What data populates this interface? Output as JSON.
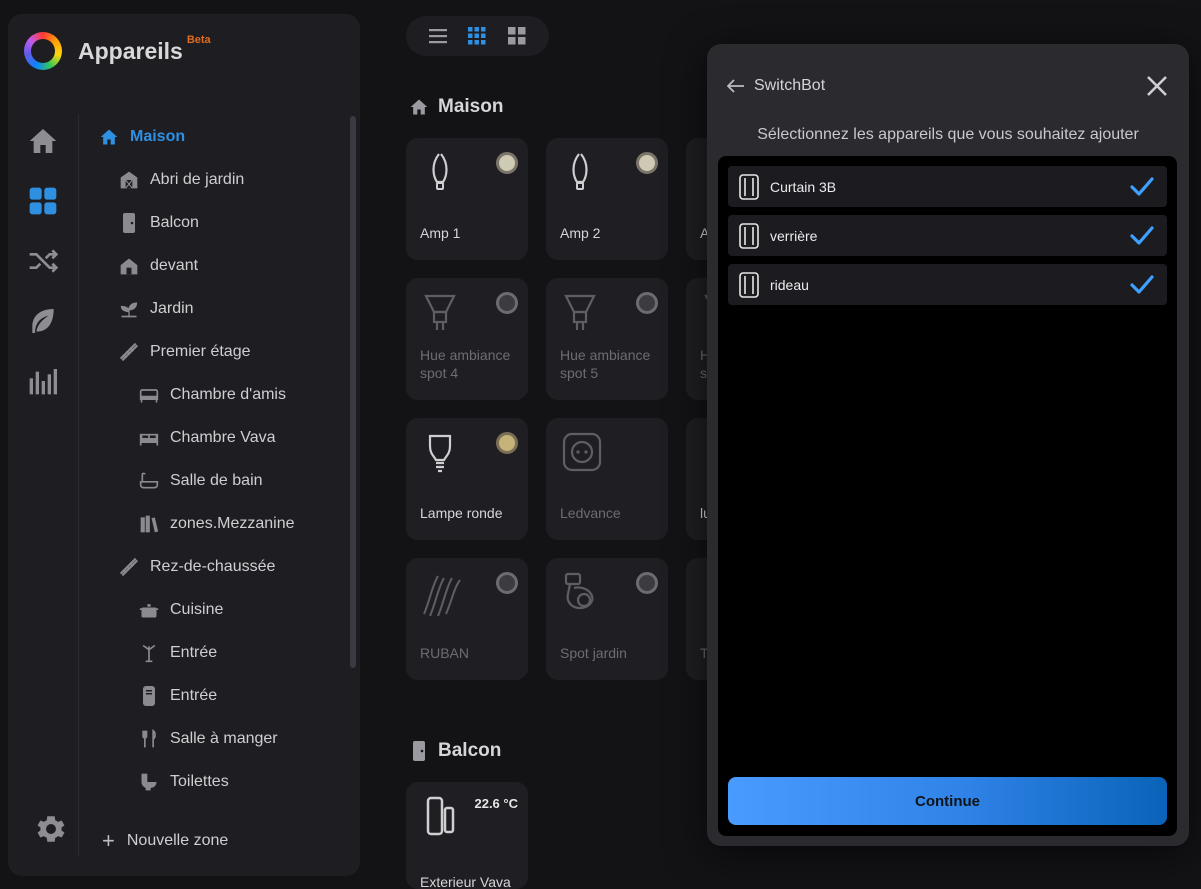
{
  "app": {
    "name": "Appareils",
    "badge": "Beta"
  },
  "zones": [
    {
      "label": "Maison",
      "icon": "house-icon",
      "level": 0,
      "active": true
    },
    {
      "label": "Abri de jardin",
      "icon": "shed-icon",
      "level": 1
    },
    {
      "label": "Balcon",
      "icon": "door-icon",
      "level": 1
    },
    {
      "label": "devant",
      "icon": "house-small-icon",
      "level": 1
    },
    {
      "label": "Jardin",
      "icon": "plant-icon",
      "level": 1
    },
    {
      "label": "Premier étage",
      "icon": "stairs-icon",
      "level": 1
    },
    {
      "label": "Chambre d'amis",
      "icon": "bed-icon",
      "level": 2
    },
    {
      "label": "Chambre Vava",
      "icon": "double-bed-icon",
      "level": 2
    },
    {
      "label": "Salle de bain",
      "icon": "bathtub-icon",
      "level": 2
    },
    {
      "label": "zones.Mezzanine",
      "icon": "books-icon",
      "level": 2
    },
    {
      "label": "Rez-de-chaussée",
      "icon": "stairs-icon",
      "level": 1
    },
    {
      "label": "Cuisine",
      "icon": "pot-icon",
      "level": 2
    },
    {
      "label": "Entrée",
      "icon": "coat-rack-icon",
      "level": 2
    },
    {
      "label": "Entrée",
      "icon": "locker-icon",
      "level": 2
    },
    {
      "label": "Salle à manger",
      "icon": "cutlery-icon",
      "level": 2
    },
    {
      "label": "Toilettes",
      "icon": "toilet-icon",
      "level": 2
    }
  ],
  "new_zone_label": "Nouvelle zone",
  "sections": {
    "maison": {
      "title": "Maison"
    },
    "balcon": {
      "title": "Balcon"
    }
  },
  "cards": [
    {
      "label": "Amp 1",
      "icon": "candle-bulb-icon",
      "state": "on-white",
      "dim": false
    },
    {
      "label": "Amp 2",
      "icon": "candle-bulb-icon",
      "state": "on-white",
      "dim": false
    },
    {
      "label": "A",
      "icon": "bulb-icon",
      "state": "none",
      "dim": false
    },
    {
      "label": "Hue ambiance\nspot 4",
      "icon": "spot-bulb-icon",
      "state": "off",
      "dim": true
    },
    {
      "label": "Hue ambiance\nspot 5",
      "icon": "spot-bulb-icon",
      "state": "off",
      "dim": true
    },
    {
      "label": "H\ns",
      "icon": "spot-bulb-icon",
      "state": "none",
      "dim": true
    },
    {
      "label": "Lampe ronde",
      "icon": "bulb-icon",
      "state": "on",
      "dim": false
    },
    {
      "label": "Ledvance",
      "icon": "outlet-icon",
      "state": "none",
      "dim": true
    },
    {
      "label": "lu",
      "icon": "bulb-icon",
      "state": "none",
      "dim": false
    },
    {
      "label": "RUBAN",
      "icon": "lightstrip-icon",
      "state": "off",
      "dim": true
    },
    {
      "label": "Spot jardin",
      "icon": "spotlight-icon",
      "state": "off",
      "dim": true
    },
    {
      "label": "T",
      "icon": "device-icon",
      "state": "none",
      "dim": true
    }
  ],
  "balcon_card": {
    "label": "Exterieur Vava",
    "temp": "22.6 °C",
    "icon": "door-sensor-icon"
  },
  "modal": {
    "title": "SwitchBot",
    "subtitle": "Sélectionnez les appareils que vous souhaitez ajouter",
    "devices": [
      {
        "name": "Curtain 3B",
        "checked": true
      },
      {
        "name": "verrière",
        "checked": true
      },
      {
        "name": "rideau",
        "checked": true
      }
    ],
    "continue_label": "Continue"
  },
  "colors": {
    "accent": "#2f8fe0",
    "check": "#3ea0ff",
    "background": "#131316",
    "panel": "#1e1e22",
    "modal": "#2a2a2f",
    "beta": "#e06a1a"
  }
}
